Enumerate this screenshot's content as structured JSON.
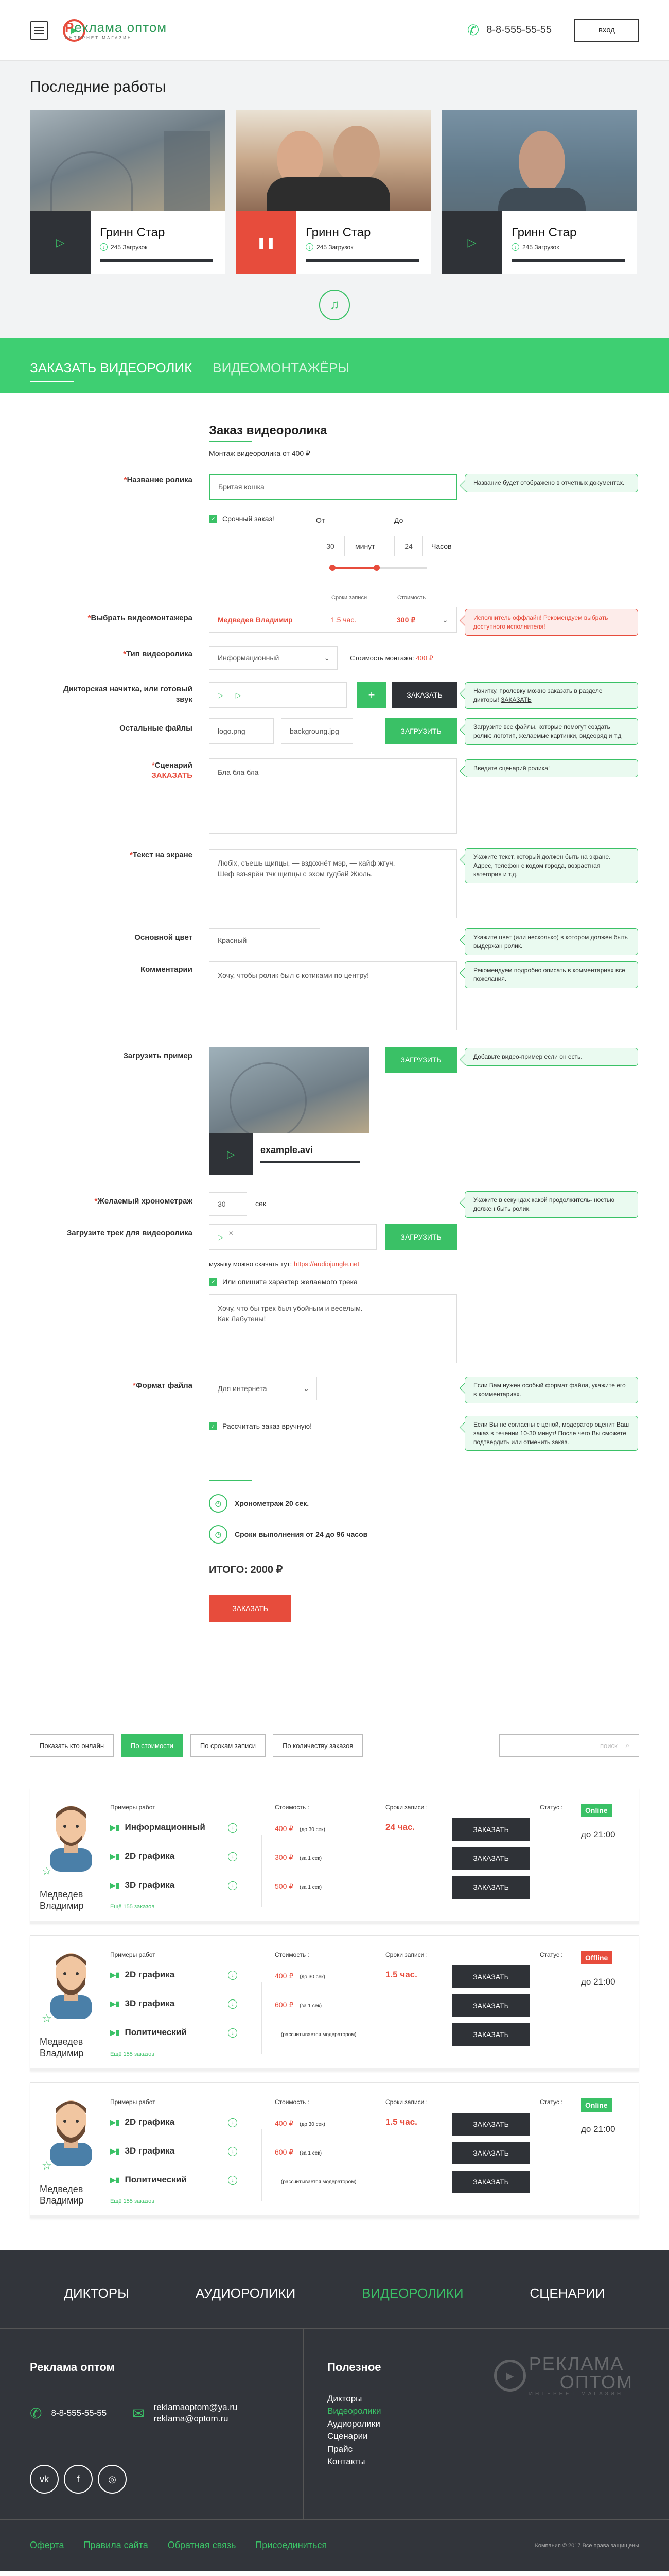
{
  "header": {
    "logo_big_1": "Р",
    "logo_big_2": "еклама",
    "logo_big_3": "оптом",
    "logo_small": "ИНТЕРНЕТ МАГАЗИН",
    "phone": "8-8-555-55-55",
    "login_label": "вход"
  },
  "recent": {
    "title": "Последние работы",
    "cards": [
      {
        "name": "Гринн Стар",
        "downloads": "245 Загрузок",
        "play": "▷"
      },
      {
        "name": "Гринн Стар",
        "downloads": "245 Загрузок",
        "play": "❚❚"
      },
      {
        "name": "Гринн Стар",
        "downloads": "245 Загрузок",
        "play": "▷"
      }
    ]
  },
  "tabs": {
    "order": "Заказать видеоролик",
    "editors": "Видеомонтажёры"
  },
  "form": {
    "title": "Заказ видеоролика",
    "subtitle": "Монтаж видеоролика от 400 ₽",
    "name_label": "Название ролика",
    "name_value": "Бритая кошка",
    "name_hint": "Название будет отображено в отчетных документах.",
    "urgent": "Срочный заказ!",
    "from": "От",
    "to": "До",
    "from_val": "30",
    "minutes": "минут",
    "to_val": "24",
    "hours": "Часов",
    "terms_col": "Сроки записи",
    "cost_col": "Стоимость",
    "editor_label": "Выбрать видеомонтажера",
    "editor_name": "Медведев Владимир",
    "editor_term": "1.5 час.",
    "editor_price": "300 ₽",
    "editor_hint": "Исполнитель оффлайн! Рекомендуем выбрать доступного исполнителя!",
    "type_label": "Тип видеоролика",
    "type_value": "Информационный",
    "edit_cost": "Стоимость монтажа:",
    "edit_cost_val": "400 ₽",
    "voice_label": "Дикторская начитка, или готовый звук",
    "voice_add": "+",
    "order_btn": "Заказать",
    "voice_hint_1": "Начитку, пролевку можно заказать в разделе дикторы!",
    "voice_hint_link": "ЗАКАЗАТЬ",
    "files_label": "Остальные файлы",
    "file1": "logo.png",
    "file2": "backgroung.jpg",
    "upload": "Загрузить",
    "files_hint": "Загрузите все файлы, которые помогут создать ролик: логотип, желаемые картинки, видеоряд и т.д",
    "script_label": "Сценарий",
    "script_order": "ЗАКАЗАТЬ",
    "script_value": "Бла бла бла",
    "script_hint": "Введите сценарий ролика!",
    "screen_label": "Текст на экране",
    "screen_value": "Любіх, съешь щипцы, — вздохнёт мэр, — кайф жгуч.\nШеф взъярён тчк щипцы с эхом гудбай Жюль.",
    "screen_hint": "Укажите текст, который должен быть на экране. Адрес, телефон с кодом города, возрастная категория и т.д.",
    "color_label": "Основной цвет",
    "color_value": "Красный",
    "color_hint": "Укажите цвет (или несколько) в котором должен быть выдержан ролик.",
    "comment_label": "Комментарии",
    "comment_value": "Хочу, чтобы ролик был с котиками по центру!",
    "comment_hint": "Рекомендуем подробно описать в комментариях все пожелания.",
    "sample_label": "Загрузить пример",
    "sample_file": "example.avi",
    "sample_hint": "Добавьте видео-пример если он есть.",
    "chrono_label": "Желаемый хронометраж",
    "chrono_val": "30",
    "chrono_unit": "сек",
    "chrono_hint": "Укажите в секундах какой продолжитель- ностью должен быть ролик.",
    "track_label": "Загрузите трек для видеоролика",
    "music_text": "музыку можно скачать тут:",
    "music_link": "https://audiojungle.net",
    "track_check": "Или опишите характер желаемого трека",
    "track_value": "Хочу, что бы трек был убойным и веселым.\nКак Лабутены!",
    "format_label": "Формат файла",
    "format_value": "Для интернета",
    "format_hint": "Если Вам нужен особый формат файла, укажите его в комментариях.",
    "manual": "Рассчитать заказ вручную!",
    "manual_hint": "Если Вы не согласны с ценой, модератор оценит Ваш заказ в течении 10-30 минут! После чего Вы сможете подтвердить или отменить заказ.",
    "sum_chrono": "Хронометраж 20 сек.",
    "sum_terms": "Сроки выполнения от 24 до 96 часов",
    "total": "ИТОГО: 2000 ₽",
    "submit": "Заказать"
  },
  "filters": {
    "online": "Показать кто онлайн",
    "price": "По стоимости",
    "terms": "По срокам записи",
    "count": "По количеству заказов",
    "search": "поиск"
  },
  "editors": [
    {
      "name": "Медведев\nВладимир",
      "examples_title": "Примеры работ",
      "cost_title": "Стоимость :",
      "term_title": "Сроки записи :",
      "status_title": "Статус :",
      "status": "Online",
      "status_color": "#3ac166",
      "until": "до 21:00",
      "more": "Ещё 155 заказов",
      "rows": [
        {
          "ex": "Информационный",
          "price": "400 ₽",
          "note": "(до 30 сек)",
          "term": "24 час.",
          "btn": "ЗАКАЗАТЬ"
        },
        {
          "ex": "2D графика",
          "price": "300 ₽",
          "note": "(за 1 сек)",
          "term": "",
          "btn": "ЗАКАЗАТЬ"
        },
        {
          "ex": "3D графика",
          "price": "500 ₽",
          "note": "(за 1 сек)",
          "term": "",
          "btn": "ЗАКАЗАТЬ"
        }
      ]
    },
    {
      "name": "Медведев\nВладимир",
      "examples_title": "Примеры работ",
      "cost_title": "Стоимость :",
      "term_title": "Сроки записи :",
      "status_title": "Статус :",
      "status": "Offline",
      "status_color": "#e74c3c",
      "until": "до 21:00",
      "more": "Ещё 155 заказов",
      "rows": [
        {
          "ex": "2D графика",
          "price": "400 ₽",
          "note": "(до 30 сек)",
          "term": "1.5 час.",
          "btn": "ЗАКАЗАТЬ"
        },
        {
          "ex": "3D графика",
          "price": "600 ₽",
          "note": "(за 1 сек)",
          "term": "",
          "btn": "ЗАКАЗАТЬ"
        },
        {
          "ex": "Политический",
          "price": "",
          "note": "(рассчитывается модератором)",
          "term": "",
          "btn": "ЗАКАЗАТЬ"
        }
      ]
    },
    {
      "name": "Медведев\nВладимир",
      "examples_title": "Примеры работ",
      "cost_title": "Стоимость :",
      "term_title": "Сроки записи :",
      "status_title": "Статус :",
      "status": "Online",
      "status_color": "#3ac166",
      "until": "до 21:00",
      "more": "Ещё 155 заказов",
      "rows": [
        {
          "ex": "2D графика",
          "price": "400 ₽",
          "note": "(до 30 сек)",
          "term": "1.5 час.",
          "btn": "ЗАКАЗАТЬ"
        },
        {
          "ex": "3D графика",
          "price": "600 ₽",
          "note": "(за 1 сек)",
          "term": "",
          "btn": "ЗАКАЗАТЬ"
        },
        {
          "ex": "Политический",
          "price": "",
          "note": "(рассчитывается модератором)",
          "term": "",
          "btn": "ЗАКАЗАТЬ"
        }
      ]
    }
  ],
  "footer": {
    "nav": [
      "Дикторы",
      "Аудиоролики",
      "Видеоролики",
      "Сценарии"
    ],
    "company": "Реклама оптом",
    "phone": "8-8-555-55-55",
    "email1": "reklamaoptom@ya.ru",
    "email2": "reklama@optom.ru",
    "social": [
      "vk",
      "f",
      "◎"
    ],
    "useful": "Полезное",
    "links": [
      "Дикторы",
      "Видеоролики",
      "Аудиоролики",
      "Сценарии",
      "Прайс",
      "Контакты"
    ],
    "logo_big": "РЕКЛАМА",
    "logo_big2": "ОПТОМ",
    "logo_small": "ИНТЕРНЕТ МАГАЗИН",
    "bottom_links": [
      "Оферта",
      "Правила сайта",
      "Обратная связь",
      "Присоединиться"
    ],
    "copyright": "Компания © 2017 Все права защищены"
  }
}
